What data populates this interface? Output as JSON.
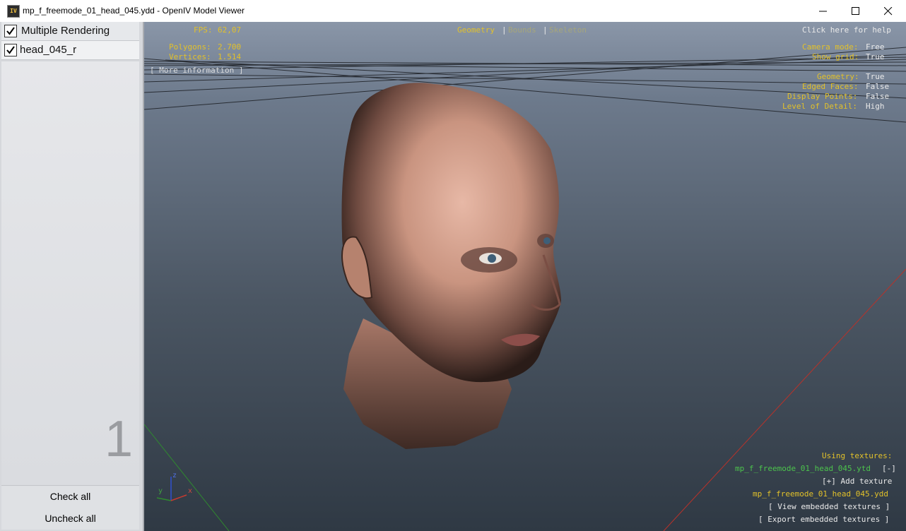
{
  "window": {
    "title": "mp_f_freemode_01_head_045.ydd - OpenIV Model Viewer",
    "icon_text": "IV"
  },
  "sidebar": {
    "items": [
      {
        "label": "Multiple Rendering",
        "checked": true
      },
      {
        "label": "head_045_r",
        "checked": true
      }
    ],
    "count": "1",
    "check_all": "Check all",
    "uncheck_all": "Uncheck all"
  },
  "viewport": {
    "fps_label": "FPS:",
    "fps_value": "62,07",
    "polygons_label": "Polygons:",
    "polygons_value": "2.700",
    "vertices_label": "Vertices:",
    "vertices_value": "1.514",
    "more_info": "[ More information ]",
    "tabs": [
      "Geometry",
      "Bounds",
      "Skeleton"
    ],
    "tab_sep": "|",
    "help": "Click here for help",
    "camera_mode_label": "Camera mode:",
    "camera_mode_value": "Free",
    "show_grid_label": "Show grid:",
    "show_grid_value": "True",
    "geometry_label": "Geometry:",
    "geometry_value": "True",
    "edged_faces_label": "Edged Faces:",
    "edged_faces_value": "False",
    "display_points_label": "Display Points:",
    "display_points_value": "False",
    "lod_label": "Level of Detail:",
    "lod_value": "High",
    "using_textures": "Using textures:",
    "texture_file": "mp_f_freemode_01_head_045.ytd",
    "texture_remove": "[-]",
    "add_texture": "[+] Add texture",
    "model_file": "mp_f_freemode_01_head_045.ydd",
    "view_embedded": "[ View embedded textures ]",
    "export_embedded": "[ Export embedded textures ]",
    "axis_labels": [
      "z",
      "y",
      "x"
    ]
  },
  "colors": {
    "accent_yellow": "#e2c12a",
    "accent_green": "#4cc34c",
    "panel_bg": "#d6d8dc"
  }
}
